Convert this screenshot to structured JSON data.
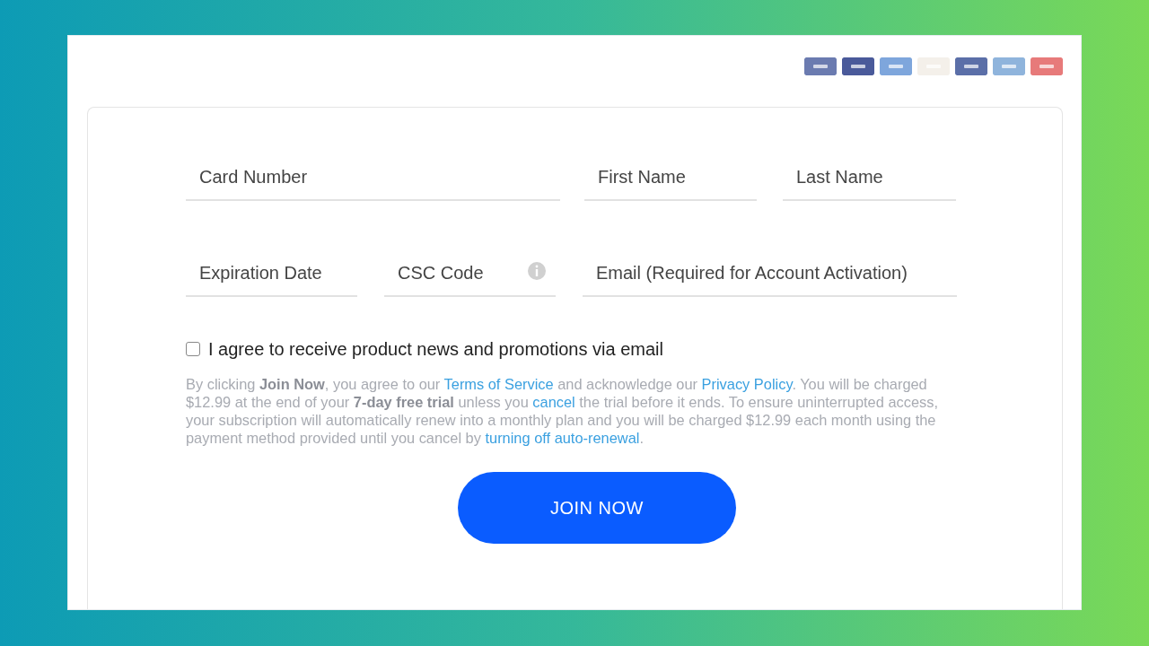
{
  "card_logos": [
    {
      "color": "#6b7bb0"
    },
    {
      "color": "#4a5a9a"
    },
    {
      "color": "#7ea6dc"
    },
    {
      "color": "#f4f0ea"
    },
    {
      "color": "#5b6fa8"
    },
    {
      "color": "#8fb4dc"
    },
    {
      "color": "#e77a7a"
    }
  ],
  "fields": [
    {
      "placeholder": "Card Number",
      "info": false
    },
    {
      "placeholder": "First Name",
      "info": false
    },
    {
      "placeholder": "Last Name",
      "info": false
    },
    {
      "placeholder": "Expiration Date",
      "info": false
    },
    {
      "placeholder": "CSC Code",
      "info": true
    },
    {
      "placeholder": "Email (Required for Account Activation)",
      "info": false
    }
  ],
  "consent": {
    "label": "I agree to receive product news and promotions via email",
    "checked": false
  },
  "legal_text": [
    {
      "kind": "plain",
      "text": "By clicking "
    },
    {
      "kind": "bold",
      "text": "Join Now"
    },
    {
      "kind": "plain",
      "text": ", you agree to our "
    },
    {
      "kind": "link",
      "text": "Terms of Service"
    },
    {
      "kind": "plain",
      "text": " and acknowledge our "
    },
    {
      "kind": "link",
      "text": "Privacy Policy"
    },
    {
      "kind": "plain",
      "text": ". You will be charged $12.99 at the end of your "
    },
    {
      "kind": "bold",
      "text": "7-day free trial"
    },
    {
      "kind": "plain",
      "text": " unless you "
    },
    {
      "kind": "link",
      "text": "cancel"
    },
    {
      "kind": "plain",
      "text": " the trial before it ends. To ensure uninterrupted access, your subscription will automatically renew into a monthly plan and you will be charged $12.99 each month using the payment method provided until you cancel by "
    },
    {
      "kind": "link",
      "text": "turning off auto-renewal"
    },
    {
      "kind": "plain",
      "text": "."
    }
  ],
  "join_button": "JOIN NOW"
}
